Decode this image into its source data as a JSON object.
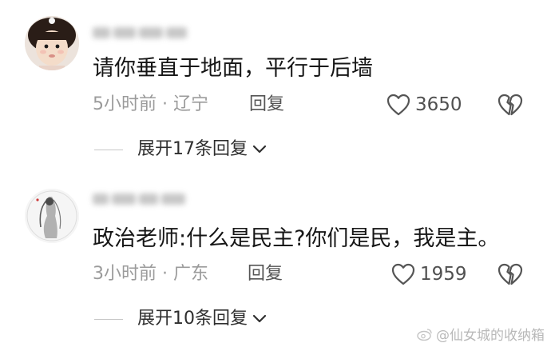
{
  "comments": [
    {
      "text": "请你垂直于地面，平行于后墙",
      "time": "5小时前",
      "location": "辽宁",
      "reply_label": "回复",
      "likes": "3650",
      "expand_label": "展开17条回复"
    },
    {
      "text": "政治老师:什么是民主?你们是民，我是主。",
      "time": "3小时前",
      "location": "广东",
      "reply_label": "回复",
      "likes": "1959",
      "expand_label": "展开10条回复"
    }
  ],
  "meta_separator": " · ",
  "watermark": "@仙女城的收纳箱",
  "colors": {
    "text": "#161616",
    "meta": "#9b9b9b",
    "icon": "#555555"
  },
  "icons": {
    "like": "heart-outline-icon",
    "dislike": "broken-heart-icon",
    "expand": "chevron-down-icon"
  }
}
